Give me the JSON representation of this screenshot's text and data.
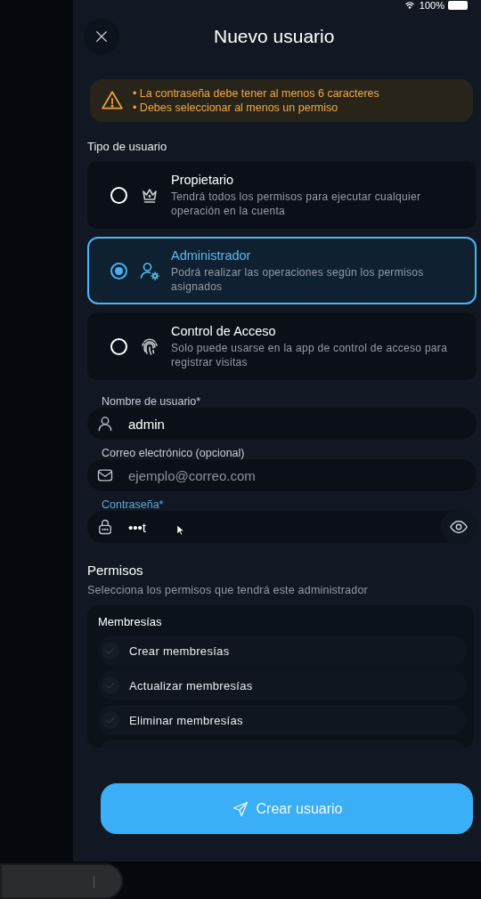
{
  "status_bar": {
    "battery_text": "100%"
  },
  "header": {
    "title": "Nuevo usuario"
  },
  "alert": {
    "messages": [
      "• La contraseña debe tener al menos 6 caracteres",
      "• Debes seleccionar al menos un permiso"
    ]
  },
  "user_type": {
    "label": "Tipo de usuario",
    "options": [
      {
        "kind": "crown",
        "title": "Propietario",
        "description": "Tendrá todos los permisos para ejecutar cualquier operación en la cuenta",
        "selected": false
      },
      {
        "kind": "admin",
        "title": "Administrador",
        "description": "Podrá realizar las operaciones según los permisos asignados",
        "selected": true
      },
      {
        "kind": "fingerprint",
        "title": "Control de Acceso",
        "description": "Solo puede usarse en la app de control de acceso para registrar visitas",
        "selected": false
      }
    ]
  },
  "fields": [
    {
      "kind": "user",
      "label": "Nombre de usuario*",
      "value": "admin",
      "focused": false
    },
    {
      "kind": "mail",
      "label": "Correo electrónico (opcional)",
      "placeholder": "ejemplo@correo.com",
      "focused": false
    },
    {
      "kind": "lock",
      "label": "Contraseña*",
      "value": "•••t",
      "focused": true
    }
  ],
  "permissions": {
    "title": "Permisos",
    "subtitle": "Selecciona los permisos que tendrá este administrador",
    "groups": [
      {
        "title": "Membresías",
        "items": [
          {
            "label": "Crear membresías",
            "checked": false
          },
          {
            "label": "Actualizar membresías",
            "checked": false
          },
          {
            "label": "Eliminar membresías",
            "checked": false
          }
        ]
      }
    ]
  },
  "submit": {
    "label": "Crear usuario"
  }
}
